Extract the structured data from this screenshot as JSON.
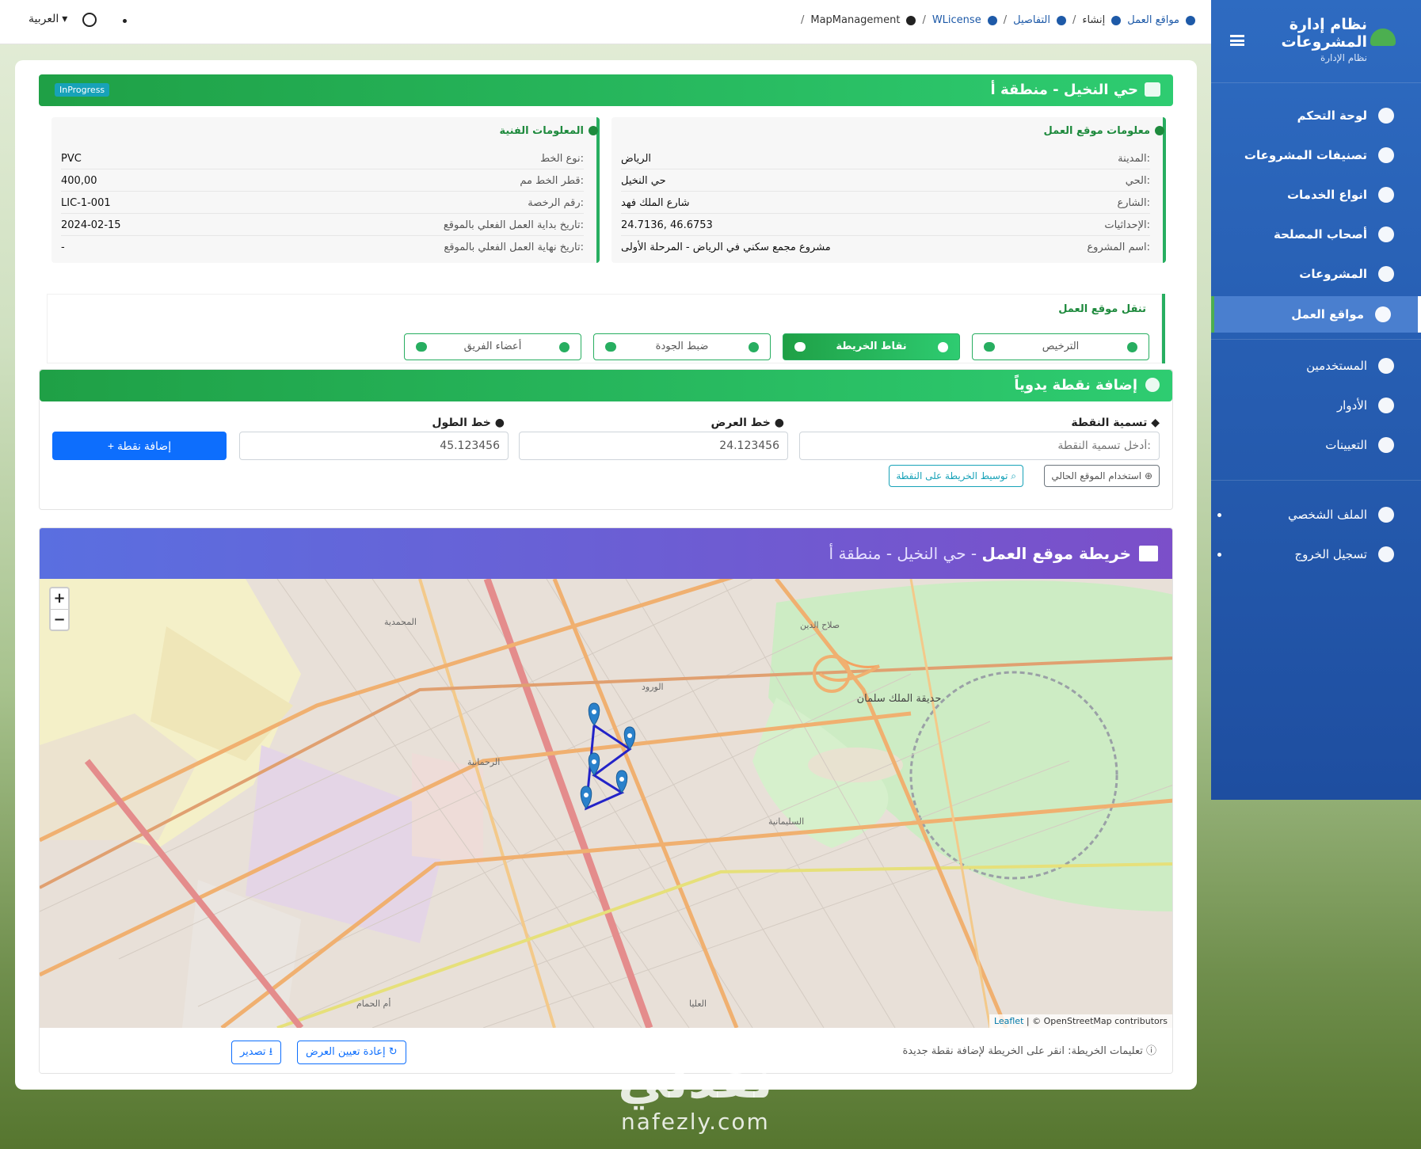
{
  "topbar": {
    "language": "العربية",
    "breadcrumbs": [
      "مواقع العمل",
      "إنشاء",
      "التفاصيل",
      "WLicense",
      "MapManagement"
    ]
  },
  "sidebar": {
    "brand_title": "نظام إدارة المشروعات",
    "brand_subtitle": "نظام الإدارة",
    "items": [
      {
        "label": "لوحة التحكم",
        "icon": "dashboard-icon"
      },
      {
        "label": "تصنيفات المشروعات",
        "icon": "tag-icon"
      },
      {
        "label": "انواع الخدمات",
        "icon": "wrench-icon"
      },
      {
        "label": "أصحاب المصلحة",
        "icon": "users-icon"
      },
      {
        "label": "المشروعات",
        "icon": "project-diagram-icon"
      },
      {
        "label": "مواقع العمل",
        "icon": "map-marker-icon"
      },
      {
        "label": "المستخدمين",
        "icon": "users-icon"
      },
      {
        "label": "الأدوار",
        "icon": "user-tag-icon"
      },
      {
        "label": "التعيينات",
        "icon": "link-icon"
      },
      {
        "label": "الملف الشخصي",
        "icon": "user-icon"
      },
      {
        "label": "تسجيل الخروج",
        "icon": "sign-out-icon"
      }
    ]
  },
  "site": {
    "title": "حي النخيل - منطقة أ",
    "status": "InProgress"
  },
  "site_info": {
    "heading": "معلومات موقع العمل",
    "rows": [
      {
        "label": "المدينة:",
        "value": "الرياض"
      },
      {
        "label": "الحي:",
        "value": "حي النخيل"
      },
      {
        "label": "الشارع:",
        "value": "شارع الملك فهد"
      },
      {
        "label": "الإحداثيات:",
        "value": "24.7136, 46.6753"
      },
      {
        "label": "اسم المشروع:",
        "value": "مشروع مجمع سكني في الرياض - المرحلة الأولى"
      }
    ]
  },
  "tech_info": {
    "heading": "المعلومات الفنية",
    "rows": [
      {
        "label": "نوع الخط:",
        "value": "PVC"
      },
      {
        "label": "قطر الخط مم:",
        "value": "400,00"
      },
      {
        "label": "رقم الرخصة:",
        "value": "LIC-1-001"
      },
      {
        "label": "تاريخ بداية العمل الفعلي بالموقع:",
        "value": "2024-02-15"
      },
      {
        "label": "تاريخ نهاية العمل الفعلي بالموقع:",
        "value": "-"
      }
    ]
  },
  "site_nav": {
    "heading": "تنقل موقع العمل",
    "tabs": [
      "الترخيص",
      "نقاط الخريطة",
      "ضبط الجودة",
      "أعضاء الفريق"
    ],
    "active": "نقاط الخريطة"
  },
  "add_point": {
    "heading": "إضافة نقطة يدوياً",
    "name_label": "تسمية النقطة",
    "name_placeholder": "أدخل تسمية النقطة:",
    "lat_label": "خط العرض",
    "lat_value": "24.123456",
    "lng_label": "خط الطول",
    "lng_value": "45.123456",
    "add_button": "+ إضافة نقطة",
    "use_location": "استخدام الموقع الحالي",
    "center_map": "توسيط الخريطة على النقطة"
  },
  "map": {
    "title_main": "خريطة موقع العمل",
    "title_sub": " - حي النخيل - منطقة أ",
    "zoom_in": "+",
    "zoom_out": "−",
    "attribution_link": "Leaflet",
    "attribution_rest": " | © OpenStreetMap contributors",
    "instructions": "تعليمات الخريطة: انقر على الخريطة لإضافة نقطة جديدة",
    "reset_button": "إعادة تعيين العرض",
    "export_button": "تصدير",
    "park_label": "حديقة الملك سلمان",
    "district_labels": [
      "الورود",
      "الرحمانية",
      "السليمانية",
      "العليا",
      "أم الحمام",
      "المحمدية",
      "صلاح الدين"
    ]
  },
  "colors": {
    "sidebar": "#2e6bc1",
    "accent_green": "#27ae60",
    "primary": "#0d6efd",
    "map_header": "#6a5fd6",
    "marker": "#2a81cb",
    "route": "#2323c8"
  },
  "watermark": {
    "logo": "نفذلي",
    "site": "nafezly.com"
  }
}
